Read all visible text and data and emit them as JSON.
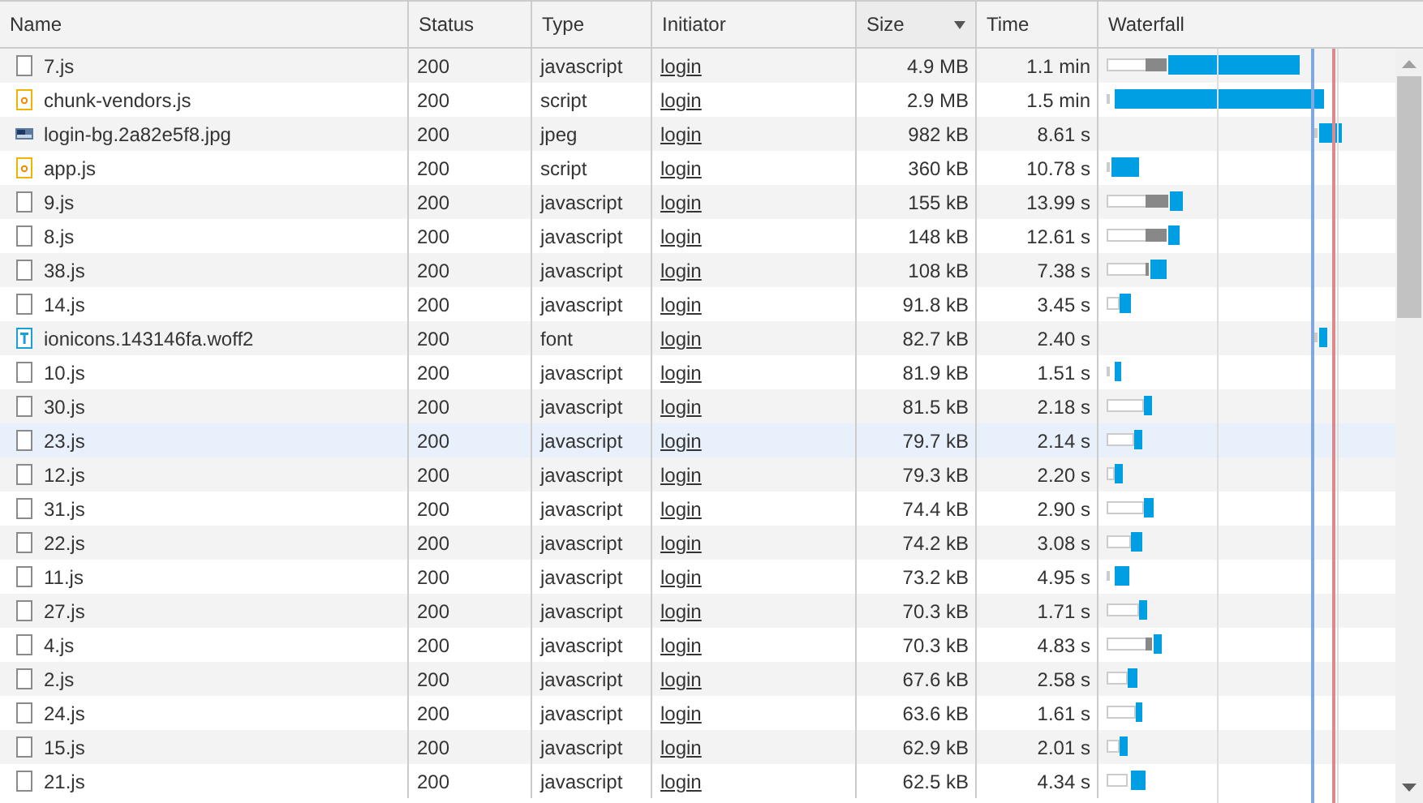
{
  "columns": [
    {
      "label": "Name",
      "sorted": false
    },
    {
      "label": "Status",
      "sorted": false
    },
    {
      "label": "Type",
      "sorted": false
    },
    {
      "label": "Initiator",
      "sorted": false
    },
    {
      "label": "Size",
      "sorted": true
    },
    {
      "label": "Time",
      "sorted": false
    },
    {
      "label": "Waterfall",
      "sorted": false
    }
  ],
  "rows": [
    {
      "kind": "file",
      "name": "7.js",
      "status": "200",
      "type": "javascript",
      "initiator": "login",
      "size": "4.9 MB",
      "time": "1.1 min",
      "selected": false
    },
    {
      "kind": "script",
      "name": "chunk-vendors.js",
      "status": "200",
      "type": "script",
      "initiator": "login",
      "size": "2.9 MB",
      "time": "1.5 min",
      "selected": false
    },
    {
      "kind": "image",
      "name": "login-bg.2a82e5f8.jpg",
      "status": "200",
      "type": "jpeg",
      "initiator": "login",
      "size": "982 kB",
      "time": "8.61 s",
      "selected": false
    },
    {
      "kind": "script",
      "name": "app.js",
      "status": "200",
      "type": "script",
      "initiator": "login",
      "size": "360 kB",
      "time": "10.78 s",
      "selected": false
    },
    {
      "kind": "file",
      "name": "9.js",
      "status": "200",
      "type": "javascript",
      "initiator": "login",
      "size": "155 kB",
      "time": "13.99 s",
      "selected": false
    },
    {
      "kind": "file",
      "name": "8.js",
      "status": "200",
      "type": "javascript",
      "initiator": "login",
      "size": "148 kB",
      "time": "12.61 s",
      "selected": false
    },
    {
      "kind": "file",
      "name": "38.js",
      "status": "200",
      "type": "javascript",
      "initiator": "login",
      "size": "108 kB",
      "time": "7.38 s",
      "selected": false
    },
    {
      "kind": "file",
      "name": "14.js",
      "status": "200",
      "type": "javascript",
      "initiator": "login",
      "size": "91.8 kB",
      "time": "3.45 s",
      "selected": false
    },
    {
      "kind": "font",
      "name": "ionicons.143146fa.woff2",
      "status": "200",
      "type": "font",
      "initiator": "login",
      "size": "82.7 kB",
      "time": "2.40 s",
      "selected": false
    },
    {
      "kind": "file",
      "name": "10.js",
      "status": "200",
      "type": "javascript",
      "initiator": "login",
      "size": "81.9 kB",
      "time": "1.51 s",
      "selected": false
    },
    {
      "kind": "file",
      "name": "30.js",
      "status": "200",
      "type": "javascript",
      "initiator": "login",
      "size": "81.5 kB",
      "time": "2.18 s",
      "selected": false
    },
    {
      "kind": "file",
      "name": "23.js",
      "status": "200",
      "type": "javascript",
      "initiator": "login",
      "size": "79.7 kB",
      "time": "2.14 s",
      "selected": true
    },
    {
      "kind": "file",
      "name": "12.js",
      "status": "200",
      "type": "javascript",
      "initiator": "login",
      "size": "79.3 kB",
      "time": "2.20 s",
      "selected": false
    },
    {
      "kind": "file",
      "name": "31.js",
      "status": "200",
      "type": "javascript",
      "initiator": "login",
      "size": "74.4 kB",
      "time": "2.90 s",
      "selected": false
    },
    {
      "kind": "file",
      "name": "22.js",
      "status": "200",
      "type": "javascript",
      "initiator": "login",
      "size": "74.2 kB",
      "time": "3.08 s",
      "selected": false
    },
    {
      "kind": "file",
      "name": "11.js",
      "status": "200",
      "type": "javascript",
      "initiator": "login",
      "size": "73.2 kB",
      "time": "4.95 s",
      "selected": false
    },
    {
      "kind": "file",
      "name": "27.js",
      "status": "200",
      "type": "javascript",
      "initiator": "login",
      "size": "70.3 kB",
      "time": "1.71 s",
      "selected": false
    },
    {
      "kind": "file",
      "name": "4.js",
      "status": "200",
      "type": "javascript",
      "initiator": "login",
      "size": "70.3 kB",
      "time": "4.83 s",
      "selected": false
    },
    {
      "kind": "file",
      "name": "2.js",
      "status": "200",
      "type": "javascript",
      "initiator": "login",
      "size": "67.6 kB",
      "time": "2.58 s",
      "selected": false
    },
    {
      "kind": "file",
      "name": "24.js",
      "status": "200",
      "type": "javascript",
      "initiator": "login",
      "size": "63.6 kB",
      "time": "1.61 s",
      "selected": false
    },
    {
      "kind": "file",
      "name": "15.js",
      "status": "200",
      "type": "javascript",
      "initiator": "login",
      "size": "62.9 kB",
      "time": "2.01 s",
      "selected": false
    },
    {
      "kind": "file",
      "name": "21.js",
      "status": "200",
      "type": "javascript",
      "initiator": "login",
      "size": "62.5 kB",
      "time": "4.34 s",
      "selected": false
    }
  ]
}
